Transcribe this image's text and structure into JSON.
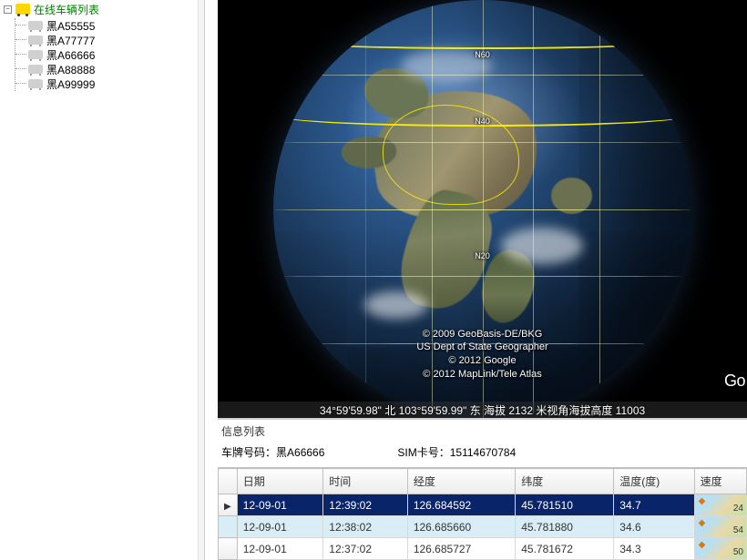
{
  "sidebar": {
    "root_label": "在线车辆列表",
    "toggle_glyph": "−",
    "vehicles": [
      {
        "plate": "黑A55555"
      },
      {
        "plate": "黑A77777"
      },
      {
        "plate": "黑A66666"
      },
      {
        "plate": "黑A88888"
      },
      {
        "plate": "黑A99999"
      }
    ]
  },
  "globe": {
    "attribution_line1": "© 2009 GeoBasis-DE/BKG",
    "attribution_line2": "US Dept of State Geographer",
    "attribution_line3": "© 2012 Google",
    "attribution_line4": "© 2012 MapLink/Tele Atlas",
    "logo_fragment": "Go",
    "lat_n60": "N60",
    "lat_n40": "N40",
    "lat_n20": "N20",
    "status": "34°59'59.98\" 北  103°59'59.99\" 东  海拔  2132  米视角海拔高度 11003"
  },
  "info": {
    "panel_title": "信息列表",
    "plate_label": "车牌号码：",
    "plate_value": "黑A66666",
    "sim_label": "SIM卡号：",
    "sim_value": "15114670784"
  },
  "table": {
    "headers": {
      "date": "日期",
      "time": "时间",
      "lon": "经度",
      "lat": "纬度",
      "temp": "温度(度)",
      "speed": "速度"
    },
    "rows": [
      {
        "marker": "▶",
        "selected": true,
        "date": "12-09-01",
        "time": "12:39:02",
        "lon": "126.684592",
        "lat": "45.781510",
        "temp": "34.7",
        "speed": "24"
      },
      {
        "marker": "",
        "selected": false,
        "date": "12-09-01",
        "time": "12:38:02",
        "lon": "126.685660",
        "lat": "45.781880",
        "temp": "34.6",
        "speed": "54"
      },
      {
        "marker": "",
        "selected": false,
        "date": "12-09-01",
        "time": "12:37:02",
        "lon": "126.685727",
        "lat": "45.781672",
        "temp": "34.3",
        "speed": "50"
      }
    ]
  }
}
